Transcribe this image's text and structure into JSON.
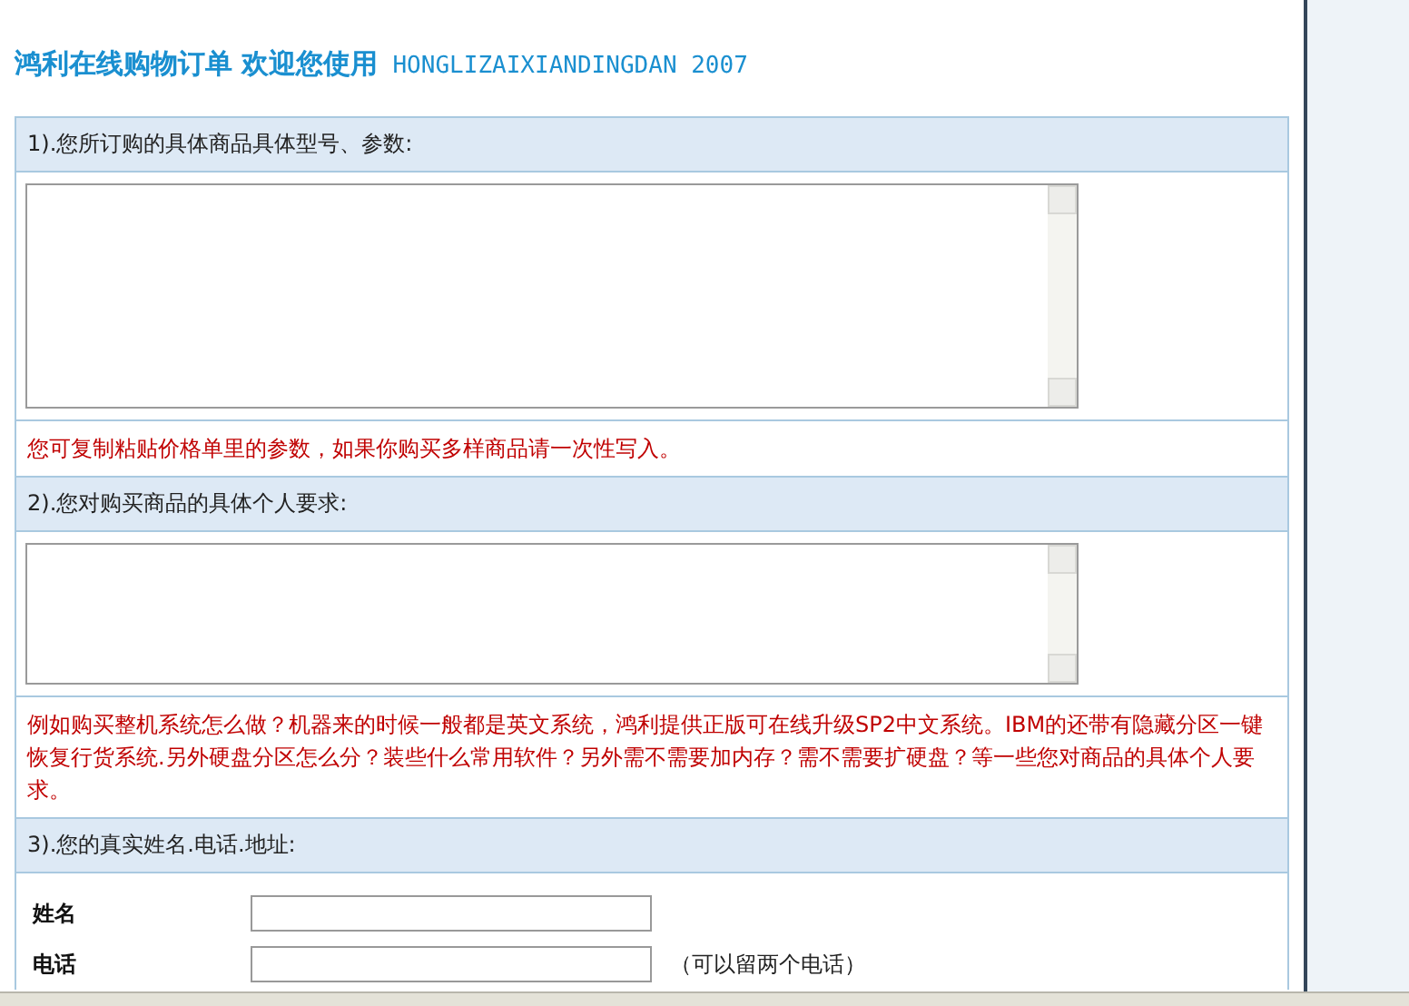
{
  "title": "鸿利在线购物订单 欢迎您使用",
  "subtitle": "HONGLIZAIXIANDINGDAN 2007",
  "sections": [
    {
      "heading": "1).您所订购的具体商品具体型号、参数:",
      "kind": "textarea-tall",
      "note": "您可复制粘贴价格单里的参数，如果你购买多样商品请一次性写入。"
    },
    {
      "heading": "2).您对购买商品的具体个人要求:",
      "kind": "textarea",
      "note": "例如购买整机系统怎么做？机器来的时候一般都是英文系统，鸿利提供正版可在线升级SP2中文系统。IBM的还带有隐藏分区一键恢复行货系统.另外硬盘分区怎么分？装些什么常用软件？另外需不需要加内存？需不需要扩硬盘？等一些您对商品的具体个人要求。"
    },
    {
      "heading": "3).您的真实姓名.电话.地址:",
      "kind": "fields",
      "fields": [
        {
          "label": "姓名"
        },
        {
          "label": "电话",
          "hint": "（可以留两个电话）"
        }
      ]
    }
  ]
}
